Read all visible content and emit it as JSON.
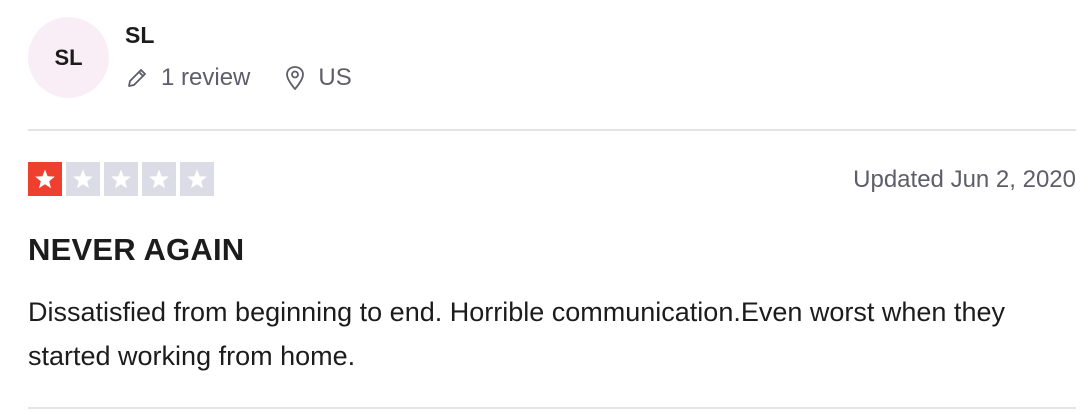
{
  "reviewer": {
    "initials": "SL",
    "name": "SL",
    "review_count": "1 review",
    "location": "US",
    "avatar_bg": "#f9eef6"
  },
  "review": {
    "rating": 1,
    "max_rating": 5,
    "star_color": "#ee3f2f",
    "empty_star_color": "#dcdce6",
    "date": "Updated Jun 2, 2020",
    "title": "NEVER AGAIN",
    "text": "Dissatisfied from beginning to end. Horrible communication.Even worst when they started working from home."
  },
  "icons": {
    "review_count": "pencil-icon",
    "location": "location-pin-icon",
    "star": "star-icon"
  }
}
